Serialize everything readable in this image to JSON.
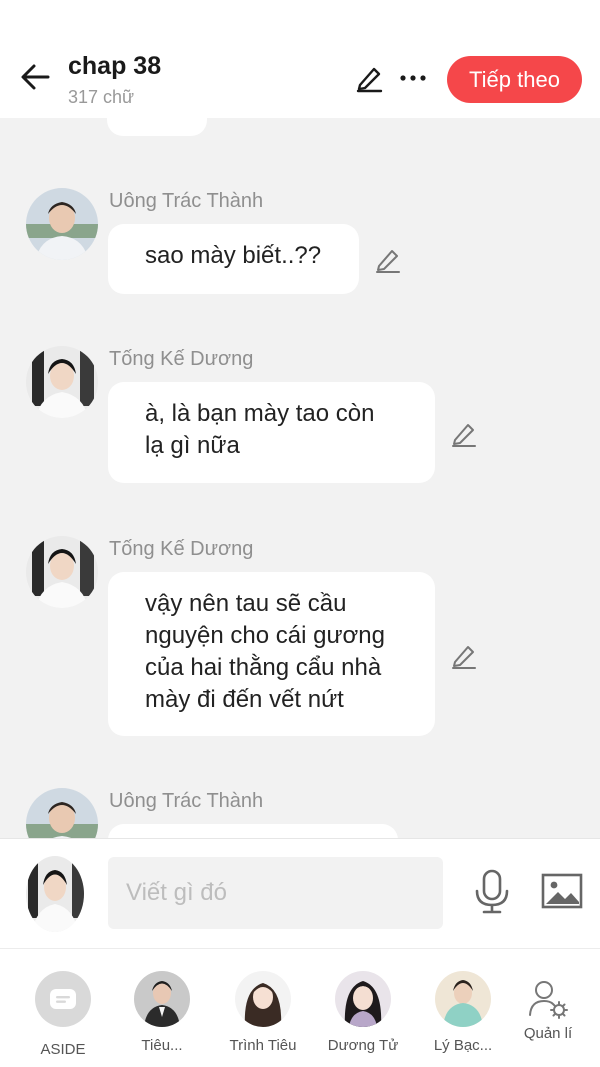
{
  "header": {
    "title": "chap 38",
    "subtitle": "317 chữ",
    "next_label": "Tiếp theo",
    "icons": [
      "back-arrow-icon",
      "pencil-icon",
      "more-icon"
    ],
    "accent_color": "#f5474a"
  },
  "messages": [
    {
      "sender": "Uông Trác Thành",
      "lines": [
        "sao mày biết..??"
      ]
    },
    {
      "sender": "Tống Kế Dương",
      "lines": [
        "à, là bạn mày tao còn",
        "lạ gì nữa"
      ]
    },
    {
      "sender": "Tống Kế Dương",
      "lines": [
        "vậy nên tau sẽ cầu",
        "nguyện cho cái gương",
        "của hai thằng cẩu nhà",
        "mày đi đến vết nứt"
      ]
    },
    {
      "sender": "Uông Trác Thành",
      "lines": []
    }
  ],
  "composer": {
    "placeholder": "Viết gì đó",
    "icons": [
      "microphone-icon",
      "image-icon"
    ]
  },
  "characters": [
    {
      "label": "ASIDE"
    },
    {
      "label": "Tiêu..."
    },
    {
      "label": "Trình Tiêu"
    },
    {
      "label": "Dương Tử"
    },
    {
      "label": "Lý Bạc..."
    },
    {
      "label": "Quản lí"
    }
  ]
}
